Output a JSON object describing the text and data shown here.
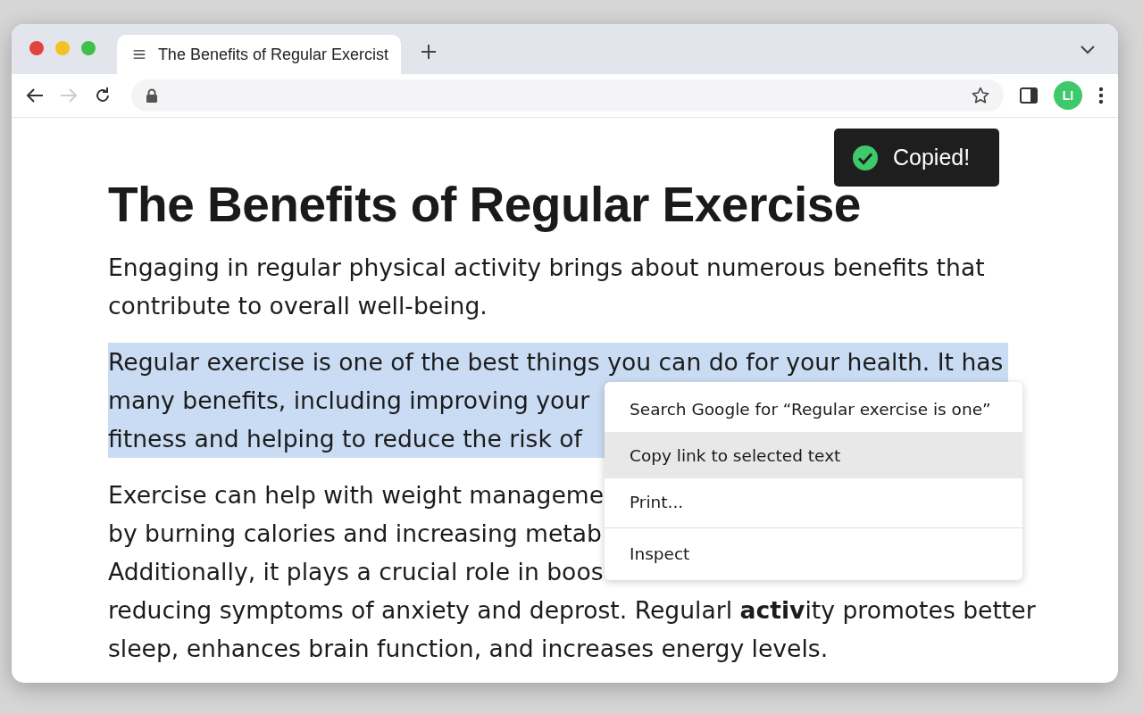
{
  "window": {
    "controls": [
      {
        "color": "#e0443e"
      },
      {
        "color": "#f4c223"
      },
      {
        "color": "#3ec04a"
      }
    ]
  },
  "tabs": [
    {
      "label": "The Benefits of Regular Exercist",
      "selected": true
    }
  ],
  "toolbar": {
    "forward_disabled": true,
    "avatar": "LI"
  },
  "toast": {
    "text": "Copied!"
  },
  "article": {
    "title": "The Benefits of Regular Exercise",
    "paragraphs": [
      {
        "selected": false,
        "lines": [
          "Engaging in regular physical activity brings about numerous benefits that",
          "contribute to overall well-being."
        ]
      },
      {
        "selected": true,
        "lines": [
          "Regular exercise is one of the best things you can do for your health. It has",
          "many benefits, including improving your",
          "fitness and helping to reduce the risk of"
        ]
      },
      {
        "selected": false,
        "lines": [
          "Exercise can help with weight manageme",
          "by burning calories and increasing metab",
          "Additionally, it plays a crucial role in boos",
          "reducing symptoms of anxiety and deprost. Regularl **activ**ity promotes better",
          "sleep, enhances brain function, and increases energy levels."
        ]
      }
    ]
  },
  "context_menu": {
    "groups": [
      [
        {
          "label": "Search Google for “Regular exercise is one”",
          "selected": false
        },
        {
          "label": "Copy link to selected text",
          "selected": true
        },
        {
          "label": "Print...",
          "selected": false
        }
      ],
      [
        {
          "label": "Inspect",
          "selected": false
        }
      ]
    ]
  }
}
